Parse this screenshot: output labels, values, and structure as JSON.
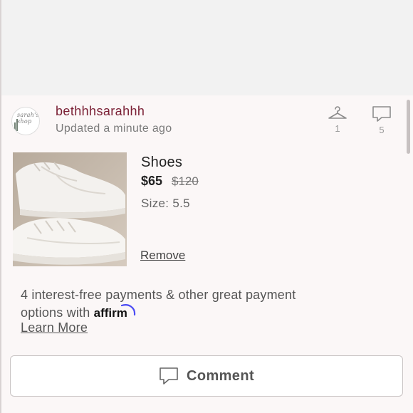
{
  "seller": {
    "username": "bethhhsarahhh",
    "updated": "Updated a minute ago",
    "avatar_text": "sarah's shop"
  },
  "stats": {
    "likes_count": "1",
    "comments_count": "5"
  },
  "item": {
    "title": "Shoes",
    "price": "$65",
    "original_price": "$120",
    "size": "Size: 5.5",
    "remove_label": "Remove",
    "image_alt": "white sneakers"
  },
  "payment": {
    "text": "4 interest-free payments & other great payment options with ",
    "provider": "affirm",
    "learn_more": "Learn More"
  },
  "comment_button": {
    "label": "Comment"
  },
  "colors": {
    "username": "#7a1f34",
    "affirm_arc": "#4a4af4",
    "background": "#fbf7f7"
  }
}
